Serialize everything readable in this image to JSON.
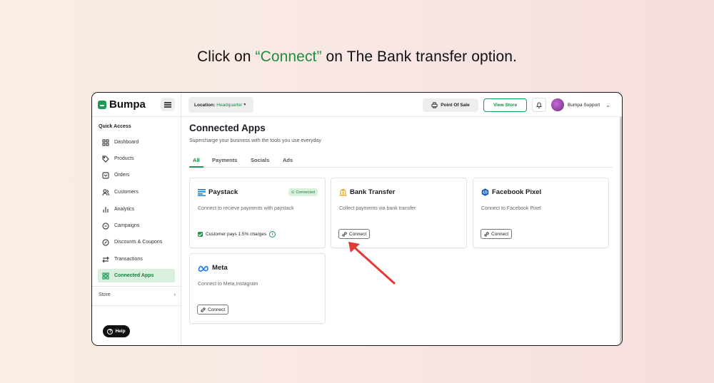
{
  "headline": {
    "before": "Click on ",
    "accent": "“Connect”",
    "after": " on The Bank transfer option."
  },
  "brand": {
    "name": "Bumpa"
  },
  "sidebar": {
    "quick_access_title": "Quick Access",
    "items": [
      {
        "label": "Dashboard",
        "icon": "grid-icon"
      },
      {
        "label": "Products",
        "icon": "tag-icon"
      },
      {
        "label": "Orders",
        "icon": "inbox-icon"
      },
      {
        "label": "Customers",
        "icon": "users-icon"
      },
      {
        "label": "Analytics",
        "icon": "bar-chart-icon"
      },
      {
        "label": "Campaigns",
        "icon": "chat-icon"
      },
      {
        "label": "Discounts & Coupons",
        "icon": "discount-icon"
      },
      {
        "label": "Transactions",
        "icon": "transfer-icon"
      },
      {
        "label": "Connected Apps",
        "icon": "apps-icon",
        "active": true
      }
    ],
    "store_label": "Store",
    "help_label": "Help"
  },
  "topbar": {
    "location_label": "Location:",
    "location_value": "Headquarter",
    "point_of_sale": "Point Of Sale",
    "view_store": "View Store",
    "user_name": "Bumpa Support"
  },
  "main": {
    "title": "Connected Apps",
    "subtitle": "Supercharge your business with the tools you use everyday",
    "tabs": [
      "All",
      "Payments",
      "Socials",
      "Ads"
    ],
    "active_tab": "All"
  },
  "apps": [
    {
      "name": "Paystack",
      "description": "Connect to recieve payments with paystack",
      "status": "Connected",
      "extra": "Customer pays 1.5% charges"
    },
    {
      "name": "Bank Transfer",
      "description": "Collect payments via bank transfer",
      "button": "Connect"
    },
    {
      "name": "Facebook Pixel",
      "description": "Connect to Facebook Pixel",
      "button": "Connect"
    },
    {
      "name": "Meta",
      "description": "Connect to Meta,Instagram",
      "button": "Connect"
    }
  ],
  "colors": {
    "accent": "#1a9b55",
    "arrow": "#e53935"
  }
}
